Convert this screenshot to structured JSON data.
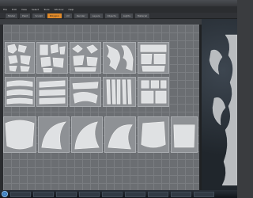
{
  "menubar": {
    "items": [
      "File",
      "Edit",
      "View",
      "Select",
      "Tools",
      "Window",
      "Help"
    ]
  },
  "tabs": [
    {
      "label": "Model",
      "active": false
    },
    {
      "label": "Paint",
      "active": false
    },
    {
      "label": "Sculpt",
      "active": false
    },
    {
      "label": "Polygon",
      "active": true
    },
    {
      "label": "UV",
      "active": false
    },
    {
      "label": "Render",
      "active": false
    },
    {
      "label": "Layers",
      "active": false
    },
    {
      "label": "Objects",
      "active": false
    },
    {
      "label": "Lights",
      "active": false
    },
    {
      "label": "Material",
      "active": false
    }
  ],
  "taskbar": {
    "items": [
      "",
      "",
      "",
      "",
      "",
      "",
      "",
      "",
      "",
      ""
    ],
    "clock": ""
  },
  "colors": {
    "accent_tab": "#e08a2a",
    "wireframe": "#f2f2f2"
  }
}
